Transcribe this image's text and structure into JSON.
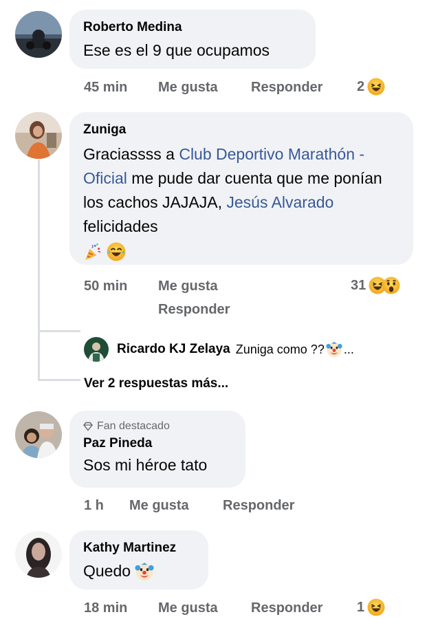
{
  "actions": {
    "like_label": "Me gusta",
    "reply_label": "Responder"
  },
  "comments": [
    {
      "author": "Roberto Medina",
      "text": "Ese es el 9 que ocupamos",
      "time": "45 min",
      "reaction_count": "2",
      "reactions": [
        "haha-emoji"
      ]
    },
    {
      "author": "Zuniga",
      "text_parts": [
        {
          "t": "Graciassss a ",
          "mention": false
        },
        {
          "t": "Club Deportivo Marathón - Oficial",
          "mention": true
        },
        {
          "t": " me pude dar cuenta que me ponían los cachos JAJAJA, ",
          "mention": false
        },
        {
          "t": "Jesús Alvarado",
          "mention": true
        },
        {
          "t": " felicidades",
          "mention": false
        }
      ],
      "trailing_emojis": [
        "party-popper-emoji",
        "tears-of-joy-emoji"
      ],
      "time": "50 min",
      "reaction_count": "31",
      "reactions": [
        "haha-emoji",
        "wow-emoji"
      ],
      "reply": {
        "author": "Ricardo KJ Zelaya",
        "text": "Zuniga como ??",
        "ellipsis": "..."
      },
      "more_replies_label": "Ver 2 respuestas más..."
    },
    {
      "badge": "Fan destacado",
      "author": "Paz Pineda",
      "text": "Sos mi héroe tato",
      "time": "1 h"
    },
    {
      "author": "Kathy Martinez",
      "text": "Quedo",
      "time": "18 min",
      "reaction_count": "1",
      "reactions": [
        "haha-emoji"
      ]
    }
  ],
  "colors": {
    "bubble_bg": "#f0f2f5",
    "mention": "#385898",
    "secondary_text": "#65676b",
    "emoji_yellow": "#f7b125"
  }
}
